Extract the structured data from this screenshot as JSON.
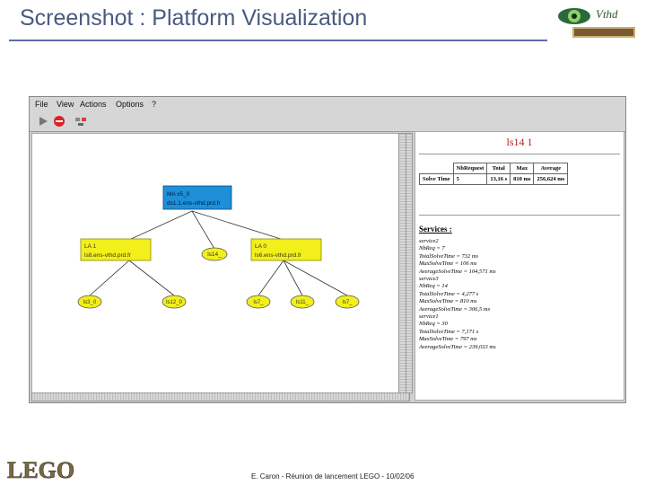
{
  "slide": {
    "title": "Screenshot : Platform Visualization",
    "footer": "E. Caron - Réunion de lancement LEGO - 10/02/06",
    "logo_text": "LEGO",
    "top_logo_text": "Vthd"
  },
  "menu": [
    "File",
    "View",
    "Actions",
    "Options",
    "?"
  ],
  "graph": {
    "nodes": [
      {
        "id": "MA",
        "line1": "MA x5_0",
        "line2": "ds1.1.ens-vthd.prd.fr",
        "kind": "agent"
      },
      {
        "id": "LA1",
        "line1": "LA 1",
        "line2": "ls8.ens-vthd.prd.fr",
        "kind": "agent"
      },
      {
        "id": "LS14",
        "line1": "ls14_",
        "line2": "",
        "kind": "sed"
      },
      {
        "id": "LA2",
        "line1": "LA 0",
        "line2": "ls6.ens-vthd.prd.fr",
        "kind": "agent"
      },
      {
        "id": "S1",
        "line1": "ls3_0",
        "line2": "",
        "kind": "sed"
      },
      {
        "id": "S2",
        "line1": "ls12_0",
        "line2": "",
        "kind": "sed"
      },
      {
        "id": "S3",
        "line1": "ls7_",
        "line2": "",
        "kind": "sed"
      },
      {
        "id": "S4",
        "line1": "ls11_",
        "line2": "",
        "kind": "sed"
      },
      {
        "id": "S5",
        "line1": "ls7_",
        "line2": "",
        "kind": "sed"
      }
    ]
  },
  "info": {
    "title": "ls14 1",
    "table": {
      "headers": [
        "",
        "NbRequest",
        "Total",
        "Max",
        "Average"
      ],
      "row": [
        "Solve Time",
        "5",
        "13,16 s",
        "810 ms",
        "256,624 ms"
      ]
    },
    "services_heading": "Services :",
    "services": [
      "service2",
      "NbReq = 7",
      "TotalSolveTime = 732 ms",
      "MaxSolveTime = 106 ms",
      "AverageSolveTime = 104,571 ms",
      "service3",
      "NbReq = 14",
      "TotalSolveTime = 4,277 s",
      "MaxSolveTime = 810 ms",
      "AverageSolveTime = 306,5 ms",
      "service1",
      "NbReq = 30",
      "TotalSolveTime = 7,171 s",
      "MaxSolveTime = 797 ms",
      "AverageSolveTime = 239,033 ms"
    ]
  },
  "colors": {
    "agent_fill": "#1e8fd8",
    "sed_fill": "#f2ef1a",
    "title_color": "#4a5a80",
    "info_title_color": "#b02020"
  }
}
